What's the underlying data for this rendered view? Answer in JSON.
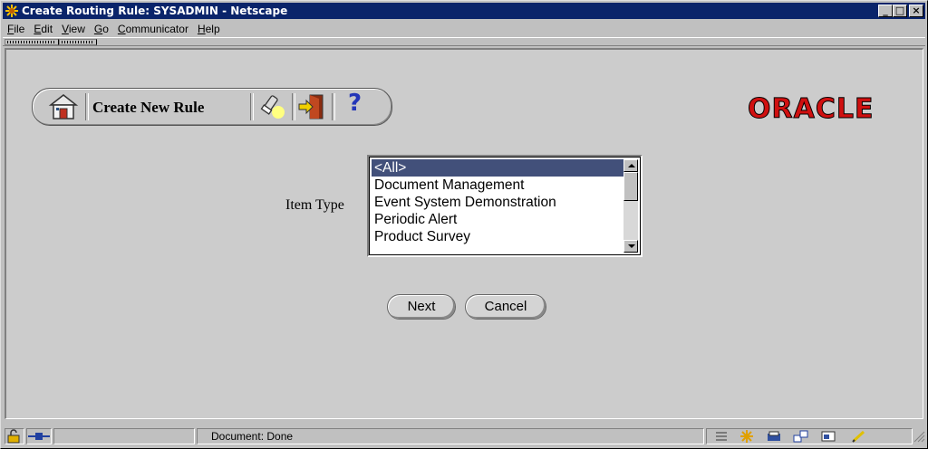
{
  "window": {
    "title": "Create Routing Rule: SYSADMIN - Netscape",
    "controls": {
      "minimize": "_",
      "maximize": "□",
      "close": "×"
    }
  },
  "menu": [
    {
      "prefix": "",
      "u": "F",
      "rest": "ile"
    },
    {
      "prefix": "",
      "u": "E",
      "rest": "dit"
    },
    {
      "prefix": "",
      "u": "V",
      "rest": "iew"
    },
    {
      "prefix": "",
      "u": "G",
      "rest": "o"
    },
    {
      "prefix": "",
      "u": "C",
      "rest": "ommunicator"
    },
    {
      "prefix": "",
      "u": "H",
      "rest": "elp"
    }
  ],
  "app_toolbar": {
    "title": "Create New Rule",
    "help_symbol": "?",
    "icons": [
      "home-icon",
      "flashlight-icon",
      "exit-door-icon",
      "help-icon"
    ]
  },
  "brand": {
    "logo_text": "ORACLE",
    "color": "#d01010"
  },
  "form": {
    "item_type_label": "Item Type",
    "item_type_options": [
      "<All>",
      "Document Management",
      "Event System Demonstration",
      "Periodic Alert",
      "Product Survey"
    ],
    "selected_option": "<All>",
    "selected_color": "#42507a"
  },
  "buttons": {
    "next": "Next",
    "cancel": "Cancel"
  },
  "status": {
    "text": "Document: Done",
    "icons": [
      "security-lock-icon",
      "connection-icon",
      "component-bar-icon",
      "navigator-icon",
      "mail-icon",
      "discussion-icon",
      "composer-icon",
      "edit-icon"
    ]
  }
}
